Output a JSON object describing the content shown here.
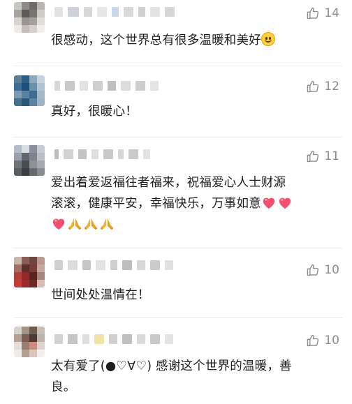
{
  "comments": [
    {
      "likes": "14",
      "text": "很感动，这个世界总有很多温暖和美好",
      "emoji": [
        "smile-emoji"
      ]
    },
    {
      "likes": "12",
      "text": "真好，很暖心！"
    },
    {
      "likes": "11",
      "lines": [
        "爱出着爱返福往者福来，祝福爱心人士财源",
        "滚滚，健康平安，幸福快乐，万事如意"
      ],
      "emoji": [
        "heart-emoji",
        "heart-emoji",
        "heart-emoji",
        "praying-hands-emoji",
        "praying-hands-emoji",
        "praying-hands-emoji"
      ]
    },
    {
      "likes": "10",
      "text": "世间处处温情在！"
    },
    {
      "likes": "10",
      "lines": [
        "太有爱了(●♡∀♡) 感谢这个世界的温暖，善",
        "良。"
      ]
    }
  ],
  "colors": {
    "text": "#1e1e1e",
    "like": "#8a8a8a",
    "heart": "#f0506e",
    "hands": "#f2b233",
    "divider": "#ececec"
  }
}
